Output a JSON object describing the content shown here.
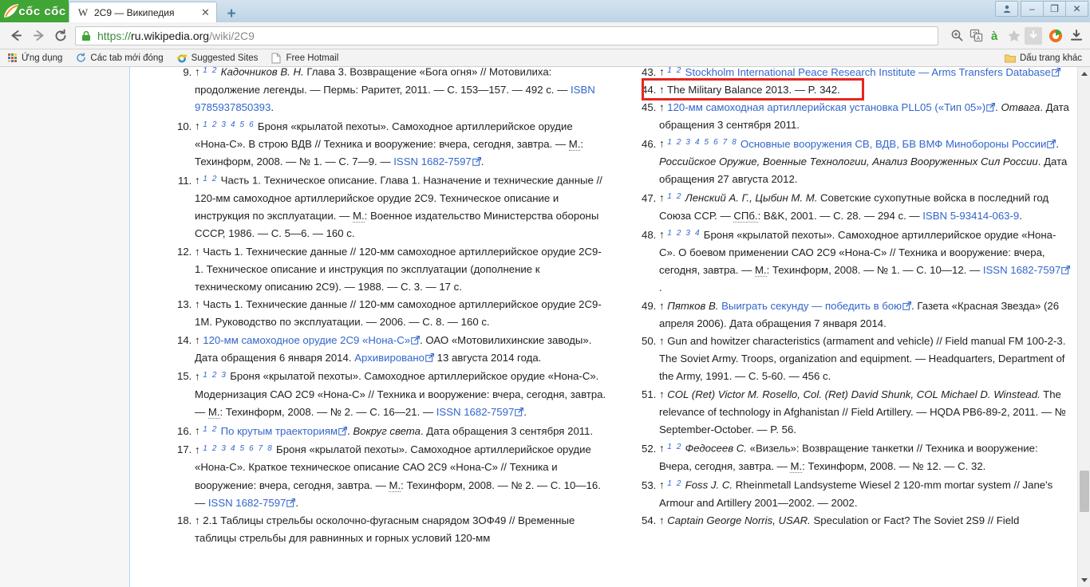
{
  "window": {
    "brand": "cốc cốc",
    "controls": {
      "user": "user-account",
      "minimize": "–",
      "restore": "❐",
      "close": "✕"
    }
  },
  "tab": {
    "favicon_letter": "W",
    "title": "2C9 — Википедия",
    "close_label": "✕",
    "newtab_label": "+"
  },
  "nav": {
    "back": "←",
    "forward": "→",
    "reload": "⟳",
    "url_scheme": "https://",
    "url_host": "ru.wikipedia.org",
    "url_path": "/wiki/2C9",
    "omni_icons": [
      "zoom-icon",
      "translate-icon",
      "vietnamese-input-icon",
      "bookmark-star-icon",
      "download-arrow-icon"
    ],
    "toolbar_icons": [
      "coccoc-menu-icon",
      "downloads-icon"
    ]
  },
  "bookmarks": {
    "items": [
      {
        "label": "Ứng dụng",
        "icon": "apps-grid-icon"
      },
      {
        "label": "Các tab mới đóng",
        "icon": "recent-tabs-icon"
      },
      {
        "label": "Suggested Sites",
        "icon": "internet-explorer-icon"
      },
      {
        "label": "Free Hotmail",
        "icon": "page-icon"
      }
    ],
    "other": {
      "label": "Dấu trang khác",
      "icon": "folder-icon"
    }
  },
  "page": {
    "scroll": {
      "up_arrow": "▲",
      "down_arrow": "▼"
    },
    "highlight": {
      "target_ref": "44",
      "color": "#e8251f"
    },
    "left_column": [
      {
        "num": "9",
        "backrefs": "1 2",
        "html": "<i class=\"it\">Кадочников В. Н.</i> Глава 3. Возвращение «Бога огня» // Мотовилиха: продолжение легенды. — Пермь: Раритет, 2011. — С. 153—157. — 492 с. — <a class=\"wl\" href=\"#\">ISBN 9785937850393</a>."
      },
      {
        "num": "10",
        "backrefs": "1 2 3 4 5 6",
        "html": "Броня «крылатой пехоты». Самоходное артиллерийское орудие «Нона-С». В строю ВДВ // Техника и вооружение: вчера, сегодня, завтра. — <span class=\"abbr\">М.</span>: Техинформ, 2008. — № 1. — С. 7—9. — <a class=\"wl\" href=\"#\">ISSN 1682-7597</a>§."
      },
      {
        "num": "11",
        "backrefs": "1 2",
        "html": "Часть 1. Техническое описание. Глава 1. Назначение и технические данные // 120-мм самоходное артиллерийское орудие 2С9. Техническое описание и инструкция по эксплуатации. — <span class=\"abbr\">М.</span>: Военное издательство Министерства обороны СССР, 1986. — С. 5—6. — 160 с."
      },
      {
        "num": "12",
        "backrefs": "",
        "html": "Часть 1. Технические данные // 120-мм самоходное артиллерийское орудие 2С9-1. Техническое описание и инструкция по эксплуатации (дополнение к техническому описанию 2С9). — 1988. — С. 3. — 17 с."
      },
      {
        "num": "13",
        "backrefs": "",
        "html": "Часть 1. Технические данные // 120-мм самоходное артиллерийское орудие 2С9-1М. Руководство по эксплуатации. — 2006. — С. 8. — 160 с."
      },
      {
        "num": "14",
        "backrefs": "",
        "html": "<a class=\"wl\" href=\"#\">120-мм самоходное орудие 2С9 «Нона-С»</a>§. ОАО «Мотовилихинские заводы». Дата обращения 6 января 2014. <a class=\"wl\" href=\"#\">Архивировано</a>§ 13 августа 2014 года."
      },
      {
        "num": "15",
        "backrefs": "1 2 3",
        "html": "Броня «крылатой пехоты». Самоходное артиллерийское орудие «Нона-С». Модернизация САО 2С9 «Нона-С» // Техника и вооружение: вчера, сегодня, завтра. — <span class=\"abbr\">М.</span>: Техинформ, 2008. — № 2. — С. 16—21. — <a class=\"wl\" href=\"#\">ISSN 1682-7597</a>§."
      },
      {
        "num": "16",
        "backrefs": "1 2",
        "html": "<a class=\"wl\" href=\"#\">По крутым траекториям</a>§. <i class=\"it\">Вокруг света</i>. Дата обращения 3 сентября 2011."
      },
      {
        "num": "17",
        "backrefs": "1 2 3 4 5 6 7 8",
        "html": "Броня «крылатой пехоты». Самоходное артиллерийское орудие «Нона-С». Краткое техническое описание САО 2С9 «Нона-С» // Техника и вооружение: вчера, сегодня, завтра. — <span class=\"abbr\">М.</span>: Техинформ, 2008. — № 2. — С. 10—16. — <a class=\"wl\" href=\"#\">ISSN 1682-7597</a>§."
      },
      {
        "num": "18",
        "backrefs": "",
        "html": "2.1 Таблицы стрельбы осколочно-фугасным снарядом 3ОФ49 // Временные таблицы стрельбы для равнинных и горных условий 120-мм"
      }
    ],
    "right_column": [
      {
        "num": "43",
        "backrefs": "1 2",
        "html": "<a class=\"wl\" href=\"#\">Stockholm International Peace Research Institute — Arms Transfers Database</a>§"
      },
      {
        "num": "44",
        "backrefs": "",
        "html": "The Military Balance 2013. — P. 342."
      },
      {
        "num": "45",
        "backrefs": "",
        "html": "<a class=\"wl\" href=\"#\">120-мм самоходная артиллерийская установка PLL05 («Тип 05»)</a>§. <i class=\"it\">Отвага</i>. Дата обращения 3 сентября 2011."
      },
      {
        "num": "46",
        "backrefs": "1 2 3 4 5 6 7 8",
        "html": "<a class=\"wl\" href=\"#\">Основные вооружения СВ, ВДВ, БВ ВМФ Минобороны России</a>§. <i class=\"it\">Российское Оружие, Военные Технологии, Анализ Вооруженных Сил России</i>. Дата обращения 27 августа 2012."
      },
      {
        "num": "47",
        "backrefs": "1 2",
        "html": "<i class=\"it\">Ленский А. Г., Цыбин М. М.</i> Советские сухопутные войска в последний год Союза ССР. — <span class=\"abbr\">СПб.</span>: B&K, 2001. — С. 28. — 294 с. — <a class=\"wl\" href=\"#\">ISBN 5-93414-063-9</a>."
      },
      {
        "num": "48",
        "backrefs": "1 2 3 4",
        "html": "Броня «крылатой пехоты». Самоходное артиллерийское орудие «Нона-С». О боевом применении САО 2С9 «Нона-С» // Техника и вооружение: вчера, сегодня, завтра. — <span class=\"abbr\">М.</span>: Техинформ, 2008. — № 1. — С. 10—12. — <a class=\"wl\" href=\"#\">ISSN 1682-7597</a>§."
      },
      {
        "num": "49",
        "backrefs": "",
        "html": "<i class=\"it\">Пятков В.</i> <a class=\"wl\" href=\"#\">Выиграть секунду — победить в бою</a>§. Газета «Красная Звезда» (26 апреля 2006). Дата обращения 7 января 2014."
      },
      {
        "num": "50",
        "backrefs": "",
        "html": "Gun and howitzer characteristics (armament and vehicle) // Field manual FM 100-2-3. The Soviet Army. Troops, organization and equipment. — Headquarters, Department of the Army, 1991. — С. 5-60. — 456 с."
      },
      {
        "num": "51",
        "backrefs": "",
        "html": "<i class=\"it\">COL (Ret) Victor M. Rosello, Col. (Ret) David Shunk, COL Michael D. Winstead.</i> The relevance of technology in Afghanistan // Field Artillery. — HQDA PB6-89-2, 2011. — № September-October. — P. 56."
      },
      {
        "num": "52",
        "backrefs": "1 2",
        "html": "<i class=\"it\">Федосеев С.</i> «Визель»: Возвращение танкетки // Техника и вооружение: Вчера, сегодня, завтра. — <span class=\"abbr\">М.</span>: Техинформ, 2008. — № 12. — С. 32."
      },
      {
        "num": "53",
        "backrefs": "1 2",
        "html": "<i class=\"it\">Foss J. C.</i> Rheinmetall Landsysteme Wiesel 2 120-mm mortar system // Jane's Armour and Artillery 2001—2002. — 2002."
      },
      {
        "num": "54",
        "backrefs": "",
        "html": "<i class=\"it\">Captain George Norris, USAR.</i> Speculation or Fact? The Soviet 2S9 // Field"
      }
    ]
  }
}
